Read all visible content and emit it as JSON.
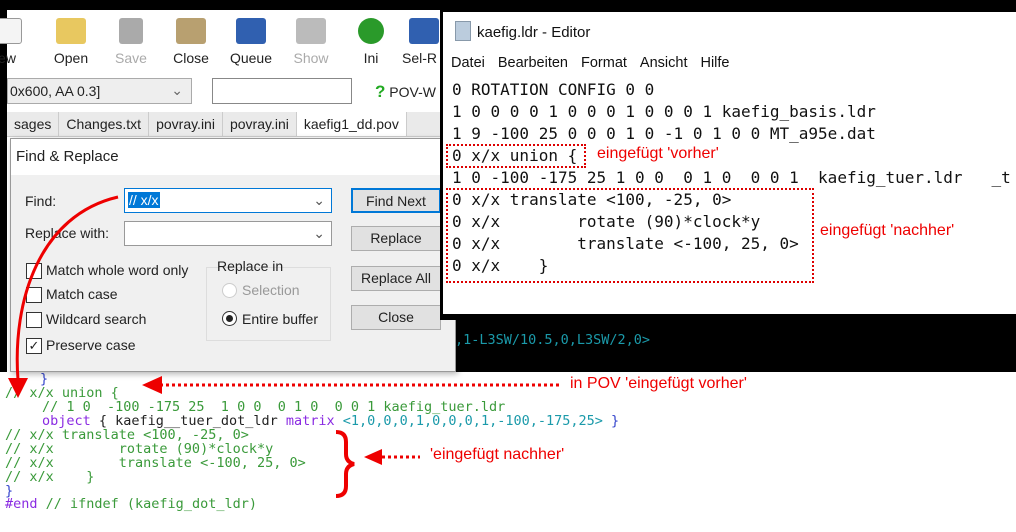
{
  "pov": {
    "toolbar": [
      {
        "label": "New",
        "shown": "ew",
        "icon": "new-file-icon",
        "enabled": true
      },
      {
        "label": "Open",
        "icon": "folder-open-icon",
        "enabled": true
      },
      {
        "label": "Save",
        "icon": "save-icon",
        "enabled": false
      },
      {
        "label": "Close",
        "icon": "folder-close-icon",
        "enabled": true
      },
      {
        "label": "Queue",
        "icon": "queue-icon",
        "enabled": true
      },
      {
        "label": "Show",
        "icon": "show-icon",
        "enabled": false
      },
      {
        "label": "Ini",
        "icon": "ini-icon",
        "enabled": true
      },
      {
        "label": "Sel-R",
        "icon": "sel-run-icon",
        "enabled": true
      }
    ],
    "resolution_combo": "0x600, AA 0.3]",
    "help_label": "POV-W",
    "tabs": [
      "sages",
      "Changes.txt",
      "povray.ini",
      "povray.ini",
      "kaefig1_dd.pov"
    ],
    "active_tab": 4,
    "code_behind": ",1-L3SW/10.5,0,L3SW/2,0>",
    "code": {
      "l0": "}",
      "l1": "// x/x union {",
      "l2": "// 1 0  -100 -175 25  1 0 0  0 1 0  0 0 1 kaefig_tuer.ldr",
      "l3a": "object",
      "l3b": " { kaefig__tuer_dot_ldr ",
      "l3c": "matrix",
      "l3d": " <1,0,0,0,1,0,0,0,1,-100,-175,25>",
      "l3e": " }",
      "l4": "// x/x translate <100, -25, 0>",
      "l5": "// x/x        rotate (90)*clock*y",
      "l6": "// x/x        translate <-100, 25, 0>",
      "l7": "// x/x    }",
      "l8": "}",
      "l9a": "#end",
      "l9b": " // ifndef (kaefig_dot_ldr)"
    }
  },
  "dialog": {
    "title": "Find & Replace",
    "find_label": "Find:",
    "find_value": "// x/x",
    "replace_label": "Replace with:",
    "replace_value": "",
    "checkboxes": [
      {
        "label": "Match whole word only",
        "checked": false
      },
      {
        "label": "Match case",
        "checked": false
      },
      {
        "label": "Wildcard search",
        "checked": false
      },
      {
        "label": "Preserve case",
        "checked": true
      }
    ],
    "replace_in": {
      "label": "Replace in",
      "options": [
        "Selection",
        "Entire buffer"
      ],
      "selected": "Entire buffer"
    },
    "buttons": [
      "Find Next",
      "Replace",
      "Replace All",
      "Close"
    ]
  },
  "notepad": {
    "title": "kaefig.ldr - Editor",
    "menu": [
      "Datei",
      "Bearbeiten",
      "Format",
      "Ansicht",
      "Hilfe"
    ],
    "lines": [
      "0 ROTATION CONFIG 0 0",
      "1 0 0 0 0 1 0 0 0 1 0 0 0 1 kaefig_basis.ldr",
      "1 9 -100 25 0 0 0 1 0 -1 0 1 0 0 MT_a95e.dat",
      "0 x/x union {",
      "1 0 -100 -175 25 1 0 0  0 1 0  0 0 1  kaefig_tuer.ldr   _t",
      "0 x/x translate <100, -25, 0>",
      "0 x/x        rotate (90)*clock*y",
      "0 x/x        translate <-100, 25, 0>",
      "0 x/x    }"
    ]
  },
  "annotations": {
    "vorher": "eingefügt 'vorher'",
    "nachher": "eingefügt 'nachher'",
    "pov_vorher": "in POV 'eingefügt vorher'",
    "pov_nachher": "'eingefügt nachher'",
    "color": "#e00000"
  }
}
